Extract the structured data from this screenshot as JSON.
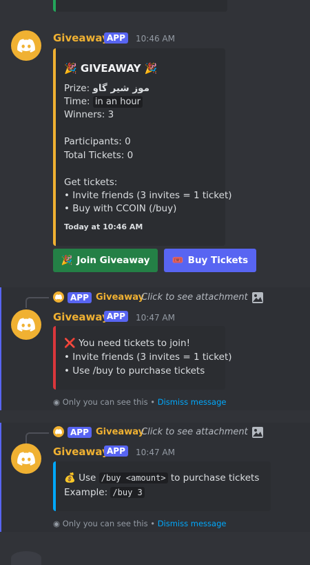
{
  "messages": [
    {
      "author": "Giveaway",
      "tag": "APP",
      "time": "10:46 AM",
      "embed": {
        "title": "🎉 GIVEAWAY 🎉",
        "prize_label": "Prize: ",
        "prize_value": "موز شیر گاو",
        "time_label": "Time: ",
        "time_value": "in an hour",
        "winners": "Winners: 3",
        "participants": "Participants: 0",
        "total_tickets": "Total Tickets: 0",
        "get_tickets": "Get tickets:",
        "invite": "• Invite friends (3 invites = 1 ticket)",
        "buy": "• Buy with CCOIN (/buy)",
        "footer": "Today at 10:46 AM",
        "bar_color": "#f0b132"
      },
      "buttons": [
        {
          "label": "Join Giveaway",
          "icon": "🎉",
          "color": "#248046"
        },
        {
          "label": "Buy Tickets",
          "icon": "🎟️",
          "color": "#5865f2"
        }
      ]
    },
    {
      "reply": {
        "tag": "APP",
        "author": "Giveaway",
        "text": "Click to see attachment"
      },
      "author": "Giveaway",
      "tag": "APP",
      "time": "10:47 AM",
      "embed": {
        "line1": "❌ You need tickets to join!",
        "line2": "• Invite friends (3 invites = 1 ticket)",
        "line3": "• Use /buy to purchase tickets",
        "bar_color": "#da373c"
      },
      "ephemeral_text": "Only you can see this • ",
      "dismiss": "Dismiss message"
    },
    {
      "reply": {
        "tag": "APP",
        "author": "Giveaway",
        "text": "Click to see attachment"
      },
      "author": "Giveaway",
      "tag": "APP",
      "time": "10:47 AM",
      "embed": {
        "use": "💰 Use ",
        "cmd": "/buy <amount>",
        "after": " to purchase tickets",
        "example_label": "Example: ",
        "example_cmd": "/buy 3",
        "bar_color": "#00a8fc"
      },
      "ephemeral_text": "Only you can see this • ",
      "dismiss": "Dismiss message"
    }
  ]
}
